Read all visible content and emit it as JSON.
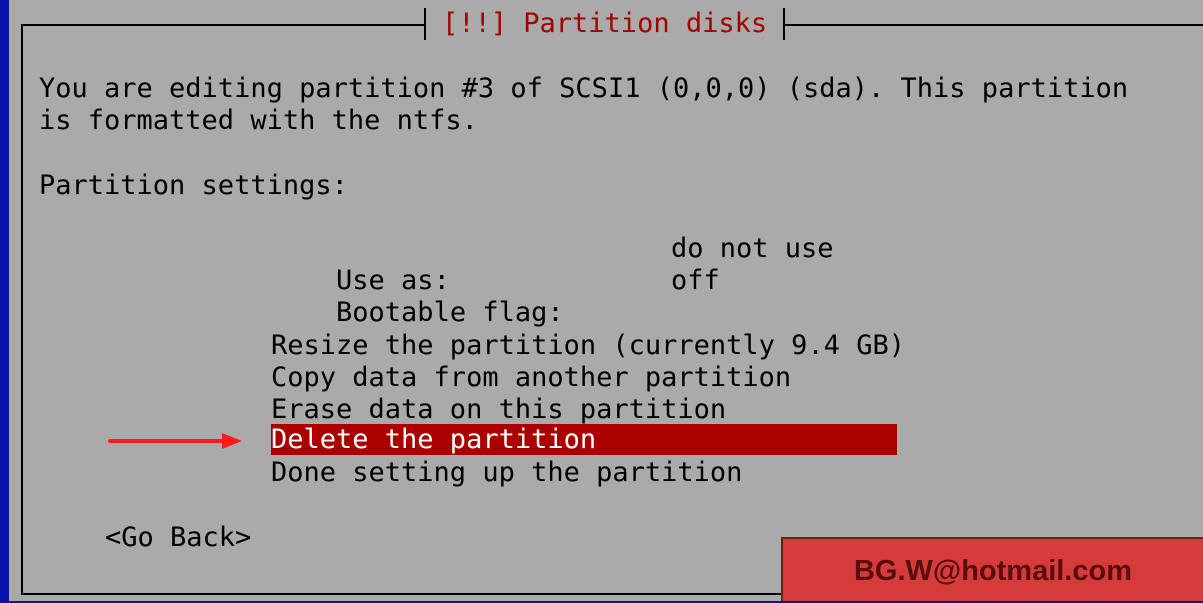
{
  "dialog": {
    "title": "[!!] Partition disks",
    "intro_line1": "You are editing partition #3 of SCSI1 (0,0,0) (sda). This partition",
    "intro_line2": "is formatted with the ntfs.",
    "settings_heading": "Partition settings:"
  },
  "settings": [
    {
      "label": "Use as:",
      "value": "do not use"
    },
    {
      "label": "Bootable flag:",
      "value": "off"
    }
  ],
  "actions": [
    {
      "label": "Resize the partition (currently 9.4 GB)",
      "selected": false
    },
    {
      "label": "Copy data from another partition",
      "selected": false
    },
    {
      "label": "Erase data on this partition",
      "selected": false
    },
    {
      "label": "Delete the partition",
      "selected": true
    },
    {
      "label": "Done setting up the partition",
      "selected": false
    }
  ],
  "go_back": "<Go Back>",
  "watermark": "BG.W@hotmail.com",
  "colors": {
    "screen_bg": "#0a14a8",
    "dialog_bg": "#aaaaaa",
    "title_text": "#a40000",
    "selection_bg": "#aa0000",
    "selection_text": "#ffffff",
    "arrow": "#ff1a1a"
  },
  "icons": {
    "pointer": "red-arrow-icon"
  }
}
